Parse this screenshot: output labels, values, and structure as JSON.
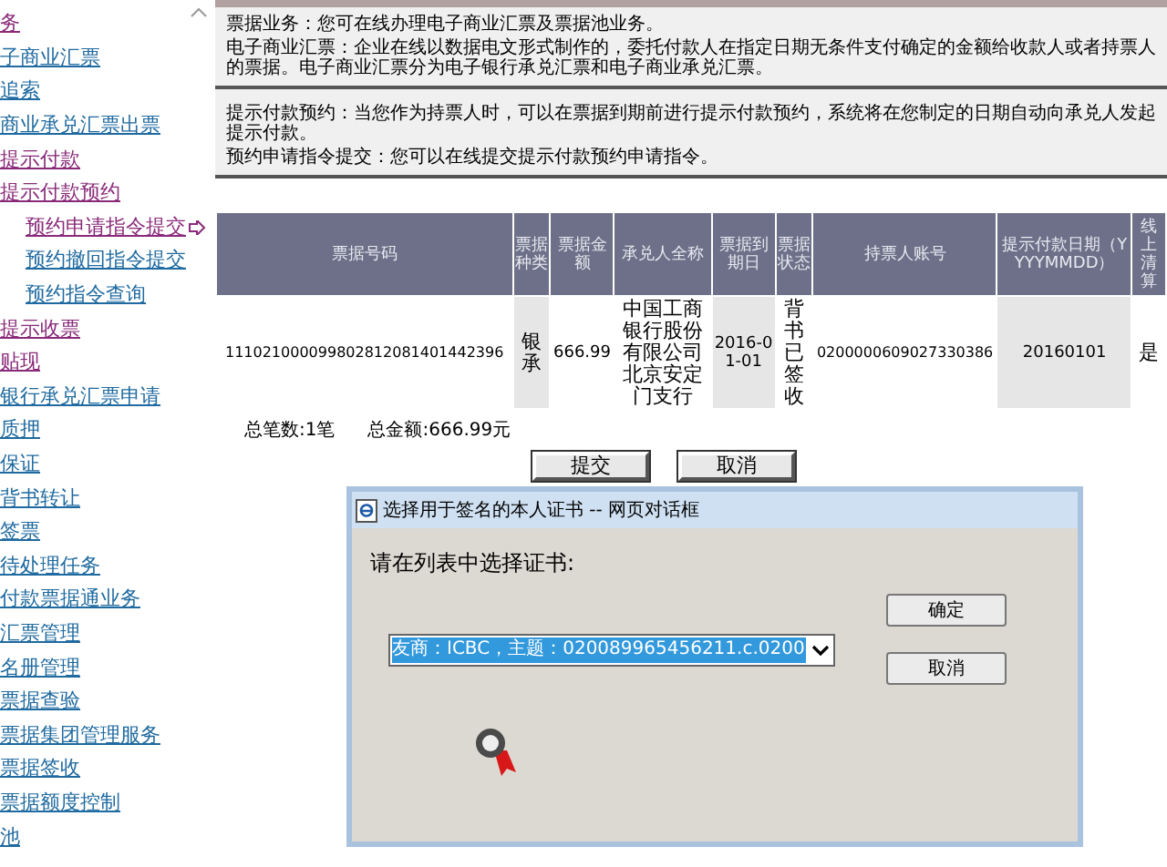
{
  "sidebar": {
    "items": [
      {
        "label": "务",
        "visited": true
      },
      {
        "label": "子商业汇票",
        "visited": false
      },
      {
        "label": "追索",
        "visited": false
      },
      {
        "label": "商业承兑汇票出票",
        "visited": false
      },
      {
        "label": "提示付款",
        "visited": true
      },
      {
        "label": "提示付款预约",
        "visited": true,
        "children": [
          {
            "label": "预约申请指令提交",
            "visited": true,
            "selected": true
          },
          {
            "label": "预约撤回指令提交",
            "visited": false,
            "selected": false
          },
          {
            "label": "预约指令查询",
            "visited": false,
            "selected": false
          }
        ]
      },
      {
        "label": "提示收票",
        "visited": true
      },
      {
        "label": "贴现",
        "visited": true
      },
      {
        "label": "银行承兑汇票申请",
        "visited": false
      },
      {
        "label": "质押",
        "visited": false
      },
      {
        "label": "保证",
        "visited": false
      },
      {
        "label": "背书转让",
        "visited": false
      },
      {
        "label": "签票",
        "visited": false
      },
      {
        "label": "待处理任务",
        "visited": false
      },
      {
        "label": "付款票据通业务",
        "visited": false
      },
      {
        "label": "汇票管理",
        "visited": false
      },
      {
        "label": "名册管理",
        "visited": false
      },
      {
        "label": "票据查验",
        "visited": false
      },
      {
        "label": "票据集团管理服务",
        "visited": false
      },
      {
        "label": "票据签收",
        "visited": false
      },
      {
        "label": "票据额度控制",
        "visited": false
      },
      {
        "label": "池",
        "visited": false
      }
    ]
  },
  "info": [
    {
      "label": "票据业务：",
      "text": "您可在线办理电子商业汇票及票据池业务。"
    },
    {
      "label": "电子商业汇票：",
      "text": "企业在线以数据电文形式制作的，委托付款人在指定日期无条件支付确定的金额给收款人或者持票人的票据。电子商业汇票分为电子银行承兑汇票和电子商业承兑汇票。"
    }
  ],
  "info2": [
    {
      "label": "提示付款预约：",
      "text": "当您作为持票人时，可以在票据到期前进行提示付款预约，系统将在您制定的日期自动向承兑人发起提示付款。"
    },
    {
      "label": "预约申请指令提交：",
      "text": "您可以在线提交提示付款预约申请指令。"
    }
  ],
  "table": {
    "columns": [
      "票据号码",
      "票据种类",
      "票据金额",
      "承兑人全称",
      "票据到期日",
      "票据状态",
      "持票人账号",
      "提示付款日期（YYYYMMDD）",
      "线上清算"
    ],
    "rows": [
      [
        "111021000099802812081401442396",
        "银承",
        "666.99",
        "中国工商银行股份有限公司北京安定门支行",
        "2016-01-01",
        "背书已签收",
        "0200000609027330386",
        "20160101",
        "是"
      ]
    ]
  },
  "totals": {
    "count": "总笔数:1笔",
    "amount": "总金额:666.99元"
  },
  "buttons": [
    "提交",
    "取消"
  ],
  "dialog": {
    "title": "选择用于签名的本人证书 -- 网页对话框",
    "prompt": "请在列表中选择证书:",
    "certificate": "友商：ICBC，主题：020089965456211.c.0200",
    "buttons": [
      "确定",
      "取消"
    ]
  }
}
